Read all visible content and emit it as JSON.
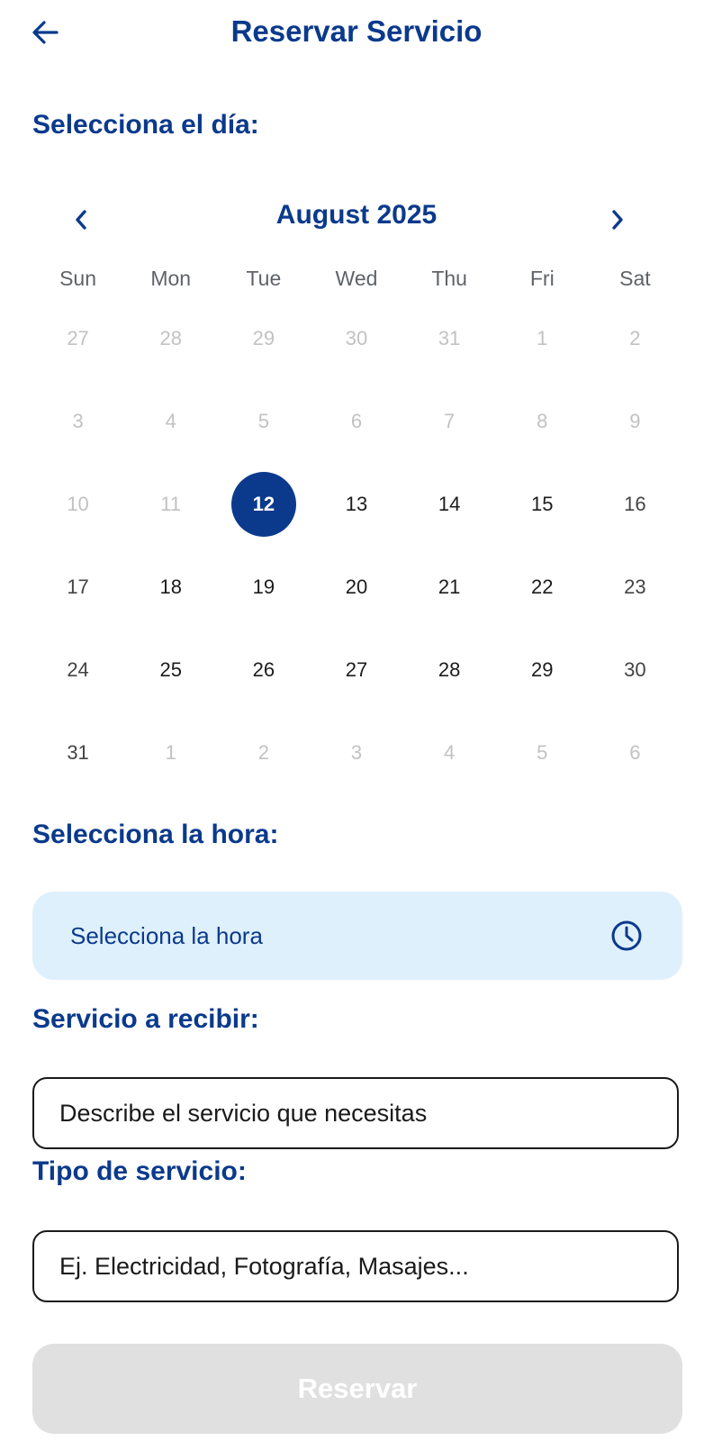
{
  "header": {
    "title": "Reservar Servicio",
    "back_icon": "arrow-left-icon"
  },
  "day_section": {
    "label": "Selecciona el día:"
  },
  "calendar": {
    "month": "August 2025",
    "prev_icon": "chevron-left-icon",
    "next_icon": "chevron-right-icon",
    "weekdays": [
      "Sun",
      "Mon",
      "Tue",
      "Wed",
      "Thu",
      "Fri",
      "Sat"
    ],
    "selected": "12",
    "days": [
      {
        "d": "27",
        "state": "muted"
      },
      {
        "d": "28",
        "state": "muted"
      },
      {
        "d": "29",
        "state": "muted"
      },
      {
        "d": "30",
        "state": "muted"
      },
      {
        "d": "31",
        "state": "muted"
      },
      {
        "d": "1",
        "state": "muted"
      },
      {
        "d": "2",
        "state": "muted"
      },
      {
        "d": "3",
        "state": "muted"
      },
      {
        "d": "4",
        "state": "muted"
      },
      {
        "d": "5",
        "state": "muted"
      },
      {
        "d": "6",
        "state": "muted"
      },
      {
        "d": "7",
        "state": "muted"
      },
      {
        "d": "8",
        "state": "muted"
      },
      {
        "d": "9",
        "state": "muted"
      },
      {
        "d": "10",
        "state": "muted"
      },
      {
        "d": "11",
        "state": "muted"
      },
      {
        "d": "12",
        "state": "selected"
      },
      {
        "d": "13",
        "state": "active"
      },
      {
        "d": "14",
        "state": "active"
      },
      {
        "d": "15",
        "state": "active"
      },
      {
        "d": "16",
        "state": "weekend"
      },
      {
        "d": "17",
        "state": "weekend"
      },
      {
        "d": "18",
        "state": "active"
      },
      {
        "d": "19",
        "state": "active"
      },
      {
        "d": "20",
        "state": "active"
      },
      {
        "d": "21",
        "state": "active"
      },
      {
        "d": "22",
        "state": "active"
      },
      {
        "d": "23",
        "state": "weekend"
      },
      {
        "d": "24",
        "state": "weekend"
      },
      {
        "d": "25",
        "state": "active"
      },
      {
        "d": "26",
        "state": "active"
      },
      {
        "d": "27",
        "state": "active"
      },
      {
        "d": "28",
        "state": "active"
      },
      {
        "d": "29",
        "state": "active"
      },
      {
        "d": "30",
        "state": "weekend"
      },
      {
        "d": "31",
        "state": "weekend"
      },
      {
        "d": "1",
        "state": "muted"
      },
      {
        "d": "2",
        "state": "muted"
      },
      {
        "d": "3",
        "state": "muted"
      },
      {
        "d": "4",
        "state": "muted"
      },
      {
        "d": "5",
        "state": "muted"
      },
      {
        "d": "6",
        "state": "muted"
      }
    ]
  },
  "time_section": {
    "label": "Selecciona la hora:",
    "placeholder": "Selecciona la hora",
    "icon": "clock-icon"
  },
  "service_section": {
    "label": "Servicio a recibir:",
    "placeholder": "Describe el servicio que necesitas"
  },
  "type_section": {
    "label": "Tipo de servicio:",
    "placeholder": "Ej. Electricidad, Fotografía, Masajes..."
  },
  "submit": {
    "label": "Reservar"
  },
  "colors": {
    "primary": "#0b3a8c",
    "time_field_bg": "#dff0fd",
    "disabled_bg": "#e0e0e0"
  }
}
